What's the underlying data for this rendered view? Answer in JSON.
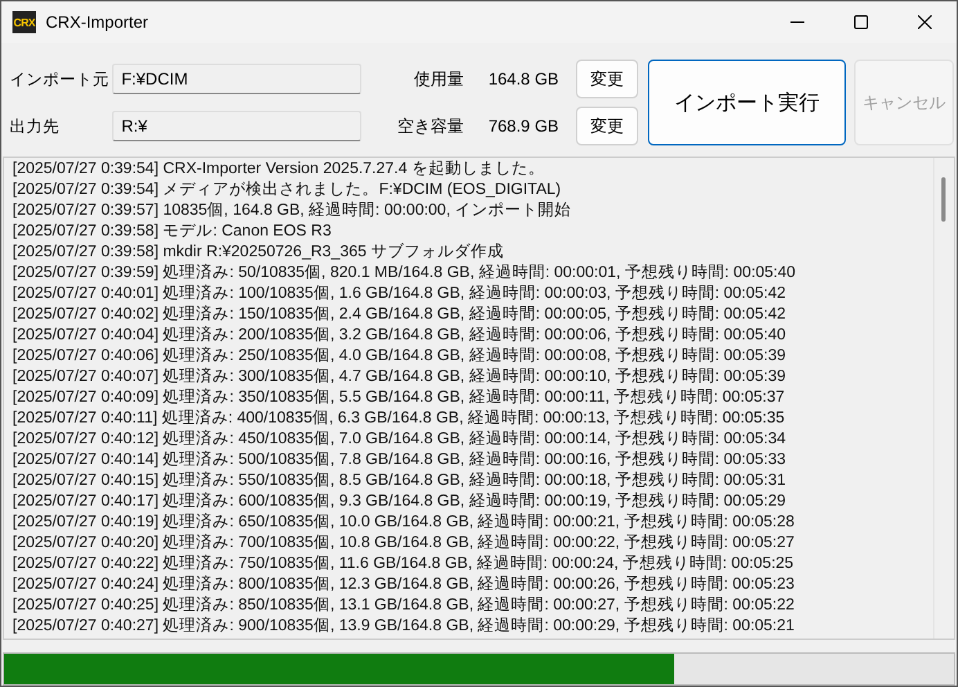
{
  "window": {
    "title": "CRX-Importer",
    "logo": "CRX"
  },
  "source": {
    "label": "インポート元",
    "value": "F:¥DCIM",
    "stat_label": "使用量",
    "stat_value": "164.8 GB",
    "button": "変更"
  },
  "destination": {
    "label": "出力先",
    "value": "R:¥",
    "stat_label": "空き容量",
    "stat_value": "768.9 GB",
    "button": "変更"
  },
  "actions": [
    {
      "label": "インポート実行",
      "disabled": false
    },
    {
      "label": "キャンセル",
      "disabled": true
    }
  ],
  "log": [
    "[2025/07/27 0:39:54] CRX-Importer Version 2025.7.27.4 を起動しました。",
    "[2025/07/27 0:39:54] メディアが検出されました。F:¥DCIM (EOS_DIGITAL)",
    "[2025/07/27 0:39:57] 10835個, 164.8 GB, 経過時間: 00:00:00, インポート開始",
    "[2025/07/27 0:39:58] モデル: Canon EOS R3",
    "[2025/07/27 0:39:58] mkdir R:¥20250726_R3_365 サブフォルダ作成",
    "[2025/07/27 0:39:59] 処理済み: 50/10835個, 820.1 MB/164.8 GB, 経過時間: 00:00:01, 予想残り時間: 00:05:40",
    "[2025/07/27 0:40:01] 処理済み: 100/10835個, 1.6 GB/164.8 GB, 経過時間: 00:00:03, 予想残り時間: 00:05:42",
    "[2025/07/27 0:40:02] 処理済み: 150/10835個, 2.4 GB/164.8 GB, 経過時間: 00:00:05, 予想残り時間: 00:05:42",
    "[2025/07/27 0:40:04] 処理済み: 200/10835個, 3.2 GB/164.8 GB, 経過時間: 00:00:06, 予想残り時間: 00:05:40",
    "[2025/07/27 0:40:06] 処理済み: 250/10835個, 4.0 GB/164.8 GB, 経過時間: 00:00:08, 予想残り時間: 00:05:39",
    "[2025/07/27 0:40:07] 処理済み: 300/10835個, 4.7 GB/164.8 GB, 経過時間: 00:00:10, 予想残り時間: 00:05:39",
    "[2025/07/27 0:40:09] 処理済み: 350/10835個, 5.5 GB/164.8 GB, 経過時間: 00:00:11, 予想残り時間: 00:05:37",
    "[2025/07/27 0:40:11] 処理済み: 400/10835個, 6.3 GB/164.8 GB, 経過時間: 00:00:13, 予想残り時間: 00:05:35",
    "[2025/07/27 0:40:12] 処理済み: 450/10835個, 7.0 GB/164.8 GB, 経過時間: 00:00:14, 予想残り時間: 00:05:34",
    "[2025/07/27 0:40:14] 処理済み: 500/10835個, 7.8 GB/164.8 GB, 経過時間: 00:00:16, 予想残り時間: 00:05:33",
    "[2025/07/27 0:40:15] 処理済み: 550/10835個, 8.5 GB/164.8 GB, 経過時間: 00:00:18, 予想残り時間: 00:05:31",
    "[2025/07/27 0:40:17] 処理済み: 600/10835個, 9.3 GB/164.8 GB, 経過時間: 00:00:19, 予想残り時間: 00:05:29",
    "[2025/07/27 0:40:19] 処理済み: 650/10835個, 10.0 GB/164.8 GB, 経過時間: 00:00:21, 予想残り時間: 00:05:28",
    "[2025/07/27 0:40:20] 処理済み: 700/10835個, 10.8 GB/164.8 GB, 経過時間: 00:00:22, 予想残り時間: 00:05:27",
    "[2025/07/27 0:40:22] 処理済み: 750/10835個, 11.6 GB/164.8 GB, 経過時間: 00:00:24, 予想残り時間: 00:05:25",
    "[2025/07/27 0:40:24] 処理済み: 800/10835個, 12.3 GB/164.8 GB, 経過時間: 00:00:26, 予想残り時間: 00:05:23",
    "[2025/07/27 0:40:25] 処理済み: 850/10835個, 13.1 GB/164.8 GB, 経過時間: 00:00:27, 予想残り時間: 00:05:22",
    "[2025/07/27 0:40:27] 処理済み: 900/10835個, 13.9 GB/164.8 GB, 経過時間: 00:00:29, 予想残り時間: 00:05:21"
  ],
  "progress": {
    "level": 0.705
  }
}
